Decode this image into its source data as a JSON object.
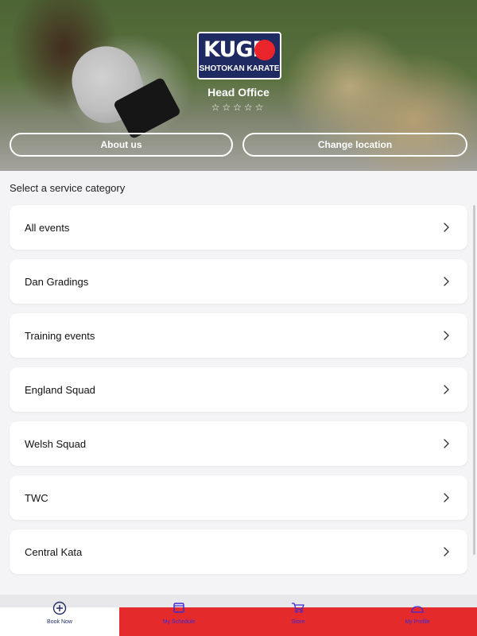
{
  "hero": {
    "logo_main": "KUGB",
    "logo_sub": "SHOTOKAN KARATE",
    "title": "Head Office",
    "stars": "☆☆☆☆☆",
    "about_label": "About us",
    "change_location_label": "Change location"
  },
  "section": {
    "title": "Select a service category"
  },
  "categories": [
    {
      "label": "All events"
    },
    {
      "label": "Dan Gradings"
    },
    {
      "label": "Training events"
    },
    {
      "label": "England Squad"
    },
    {
      "label": "Welsh Squad"
    },
    {
      "label": "TWC"
    },
    {
      "label": "Central Kata"
    }
  ],
  "bottom_nav": [
    {
      "label": "Book Now",
      "icon": "plus-circle-icon"
    },
    {
      "label": "My Schedule",
      "icon": "calendar-icon"
    },
    {
      "label": "Store",
      "icon": "cart-icon"
    },
    {
      "label": "My Profile",
      "icon": "person-icon"
    }
  ],
  "colors": {
    "brand_navy": "#1f2a63",
    "brand_red": "#e52a2c",
    "nav_link": "#3b2ad6"
  }
}
